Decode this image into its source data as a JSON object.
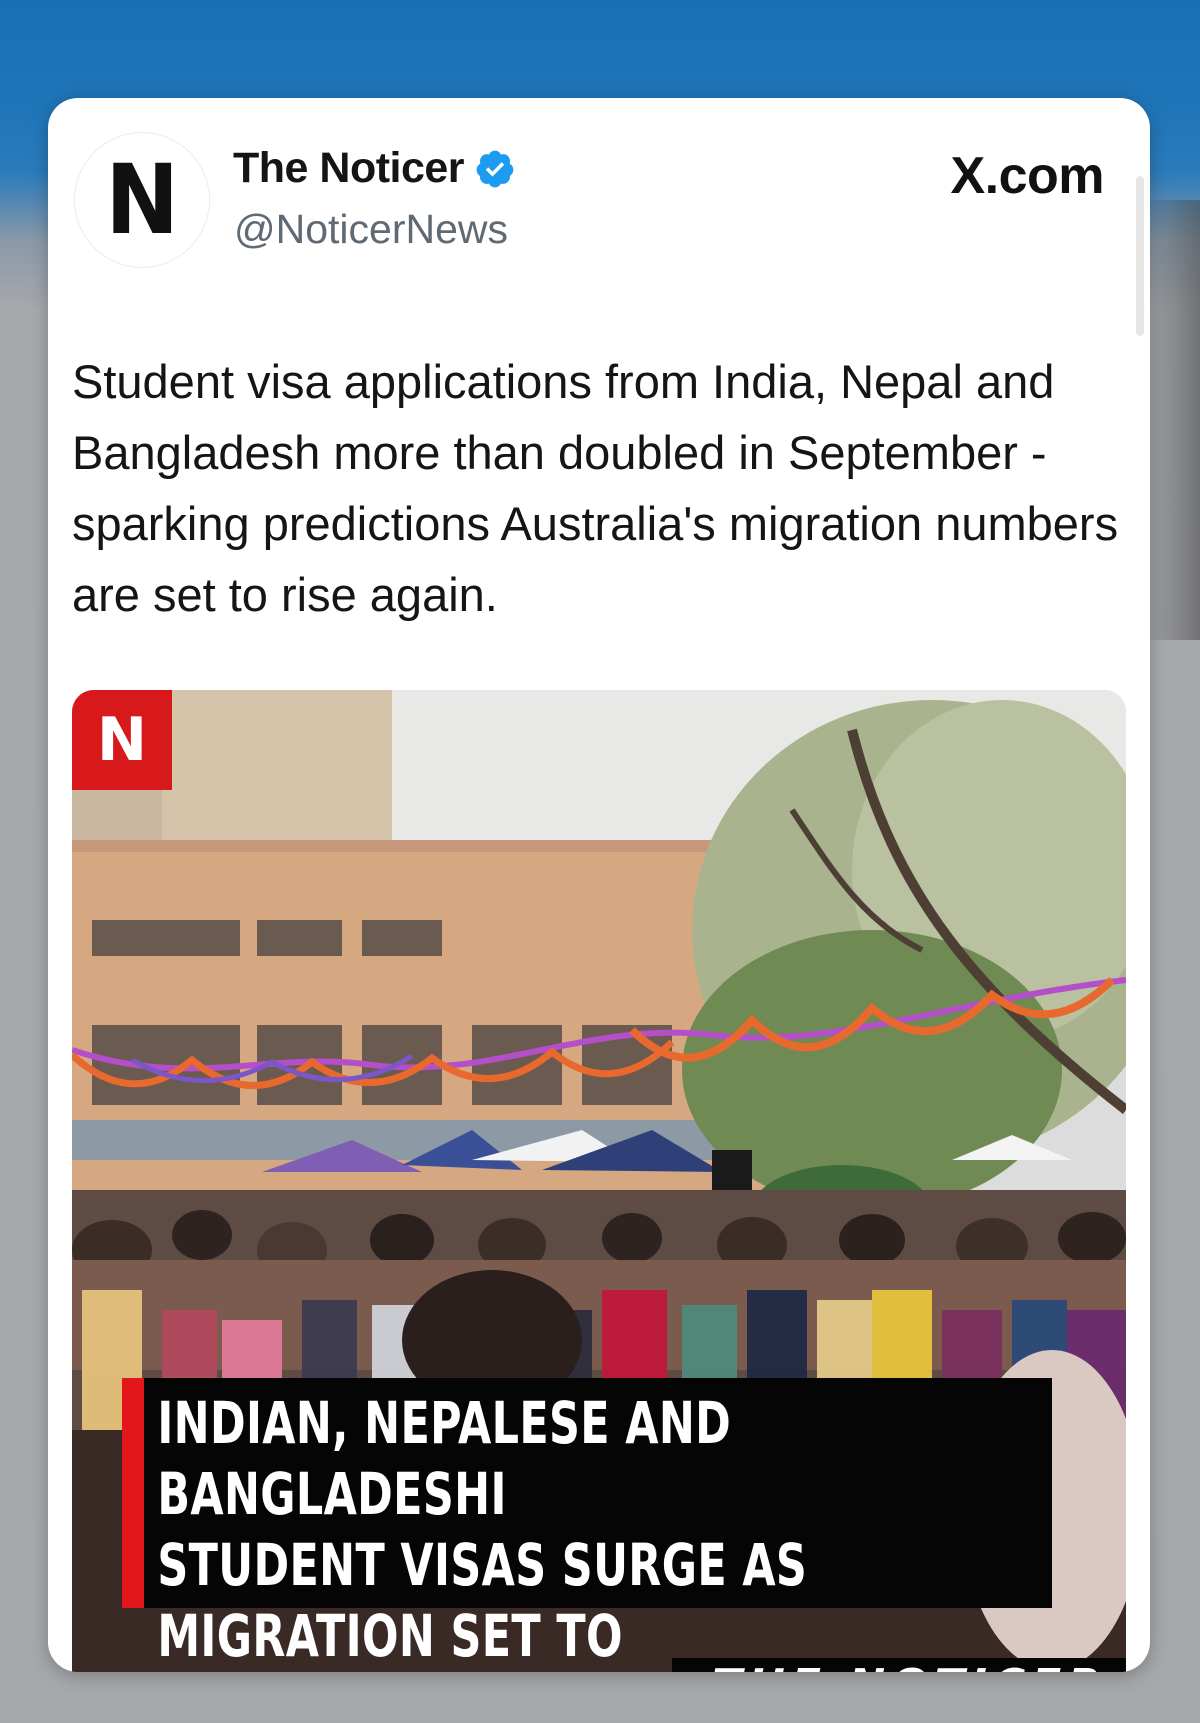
{
  "post": {
    "author": {
      "avatar_letter": "N",
      "display_name": "The Noticer",
      "handle": "@NoticerNews",
      "verified_icon": "verified-badge-icon"
    },
    "source": "X.com",
    "text": "Student visa applications from India, Nepal and Bangladesh more than doubled in September - sparking predictions Australia's migration numbers are set to rise again.",
    "media": {
      "badge_letter": "N",
      "headline": "INDIAN, NEPALESE AND BANGLADESHI\nSTUDENT VISAS SURGE AS\nMIGRATION SET TO REBOUND",
      "watermark": "THE NOTICER"
    }
  },
  "colors": {
    "verified_blue": "#1d9bf0",
    "badge_red": "#d7191c",
    "headline_accent": "#e2161b",
    "top_background": "#1a6fb3"
  }
}
